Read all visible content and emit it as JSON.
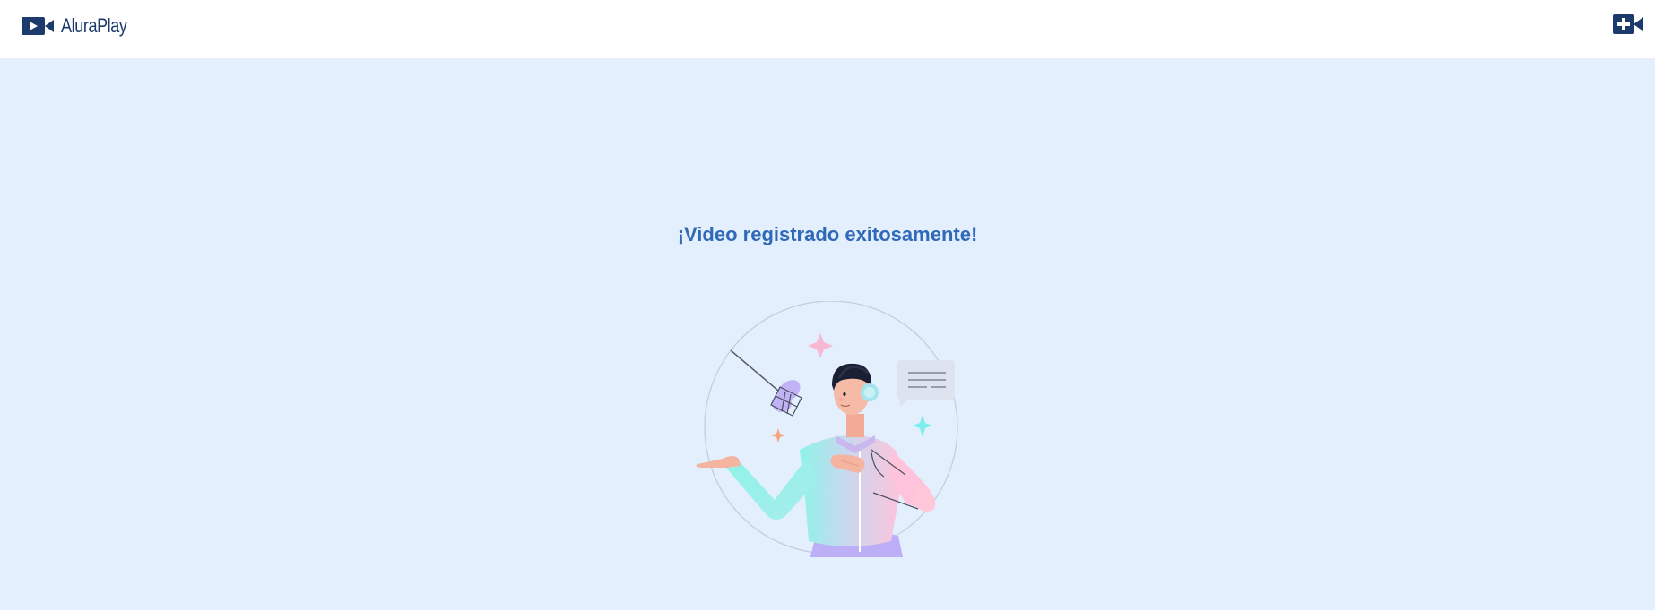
{
  "header": {
    "logo_text": "AluraPlay",
    "logo_icon": "video-camera-icon",
    "new_video_icon": "add-video-icon"
  },
  "main": {
    "success_message": "¡Video registrado exitosamente!",
    "illustration": "person-with-microphone-and-headphones-illustration"
  },
  "colors": {
    "brand_dark": "#1c3a6b",
    "title_blue": "#2f69b7",
    "background": "#e3effd"
  }
}
